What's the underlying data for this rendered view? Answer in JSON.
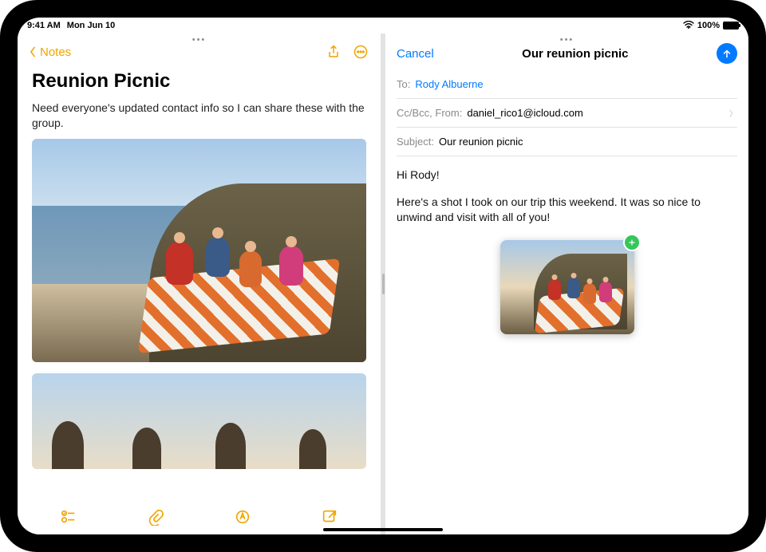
{
  "status": {
    "time": "9:41 AM",
    "date": "Mon Jun 10",
    "battery_pct": "100%"
  },
  "notes": {
    "back_label": "Notes",
    "title": "Reunion Picnic",
    "body_text": "Need everyone's updated contact info so I can share these with the group.",
    "icons": {
      "share": "share-icon",
      "more": "more-icon",
      "checklist": "checklist-icon",
      "attach": "attachment-icon",
      "draw": "markup-icon",
      "compose": "compose-icon"
    }
  },
  "mail": {
    "cancel_label": "Cancel",
    "title": "Our reunion picnic",
    "to_label": "To:",
    "to_value": "Rody Albuerne",
    "ccbcc_label": "Cc/Bcc, From:",
    "from_value": "daniel_rico1@icloud.com",
    "subject_label": "Subject:",
    "subject_value": "Our reunion picnic",
    "body_greeting": "Hi Rody!",
    "body_text": "Here's a shot I took on our trip this weekend. It was so nice to unwind and visit with all of you!"
  }
}
